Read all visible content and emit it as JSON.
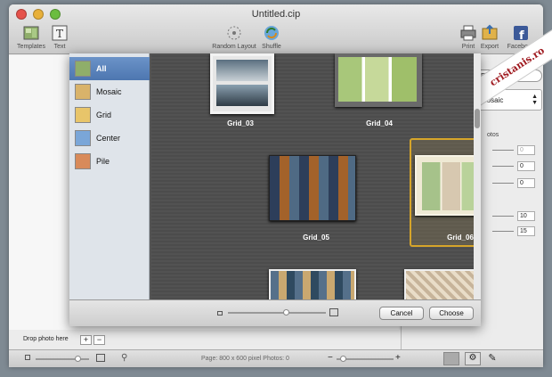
{
  "window": {
    "title": "Untitled.cip"
  },
  "toolbar": {
    "templates": "Templates",
    "text": "Text",
    "random_layout": "Random Layout",
    "shuffle": "Shuffle",
    "print": "Print",
    "export": "Export",
    "facebook": "Facebook"
  },
  "watermark": "cristanis.ro",
  "right_panel": {
    "free_mode": "Free Mode",
    "layout_select": "Mosaic",
    "photos_label": "otos",
    "fields": [
      "0",
      "0",
      "0",
      "10",
      "15"
    ]
  },
  "dialog": {
    "categories": [
      {
        "label": "All"
      },
      {
        "label": "Mosaic"
      },
      {
        "label": "Grid"
      },
      {
        "label": "Center"
      },
      {
        "label": "Pile"
      }
    ],
    "templates": [
      "Grid_03",
      "Grid_04",
      "Grid_05",
      "Grid_06"
    ],
    "cancel": "Cancel",
    "choose": "Choose"
  },
  "drop": {
    "label": "Drop photo here",
    "add": "+",
    "remove": "−"
  },
  "status": {
    "page_info": "Page: 800 x 600 pixel Photos: 0"
  },
  "colors": {
    "selection": "#d6a52a",
    "sidebar_selected": "#5a82bb"
  }
}
